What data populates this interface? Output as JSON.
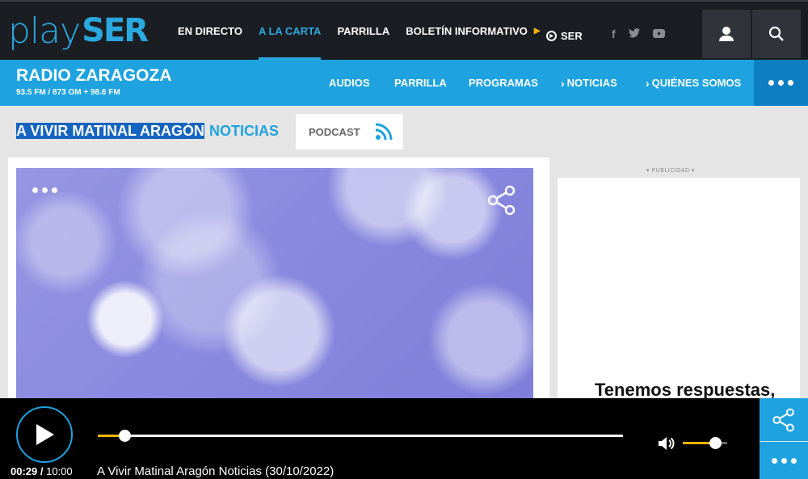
{
  "header": {
    "logo_play": "play",
    "logo_ser": "SER",
    "nav": [
      {
        "label": "EN DIRECTO",
        "active": false
      },
      {
        "label": "A LA CARTA",
        "active": true
      },
      {
        "label": "PARRILLA",
        "active": false
      },
      {
        "label": "BOLETÍN INFORMATIVO",
        "active": false
      }
    ],
    "ser_label": "SER",
    "social": [
      "f",
      "t",
      "▶"
    ],
    "user_icon": "user-icon",
    "search_icon": "search-icon"
  },
  "station": {
    "name": "RADIO ZARAGOZA",
    "frequencies": "93.5 FM / 873 OM + 98.6 FM",
    "nav": [
      "AUDIOS",
      "PARRILLA",
      "PROGRAMAS",
      "NOTICIAS",
      "QUIÉNES SOMOS"
    ]
  },
  "program": {
    "name": "A VIVIR MATINAL ARAGÓN",
    "section": "NOTICIAS",
    "podcast_label": "PODCAST"
  },
  "ad": {
    "publicidad": "PUBLICIDAD",
    "text": "Tenemos respuestas,"
  },
  "player": {
    "current_time": "00:29",
    "total_time": "10:00",
    "title": "A Vivir Matinal Aragón Noticias (30/10/2022)",
    "progress": 0.05,
    "volume": 0.73
  },
  "colors": {
    "accent": "#1ea3e0",
    "dark": "#1a1d22",
    "highlight": "#f5b400"
  }
}
